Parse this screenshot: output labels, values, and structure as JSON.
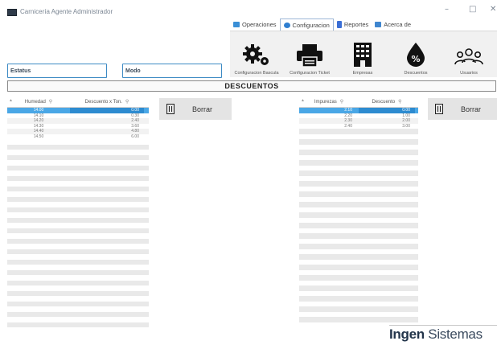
{
  "window": {
    "title": "Carnicería Agente Administrador",
    "minimize": "–",
    "maximize": "□",
    "close": "✕"
  },
  "menu": {
    "items": [
      {
        "label": "Operaciones",
        "color": "#3a8fd6",
        "active": false
      },
      {
        "label": "Configuracion",
        "color": "#2f7fd0",
        "active": true
      },
      {
        "label": "Reportes",
        "color": "#3b6fd6",
        "active": false
      },
      {
        "label": "Acerca de",
        "color": "#3f86cf",
        "active": false
      }
    ]
  },
  "toolbar": {
    "items": [
      {
        "label": "Configuracion Bascula",
        "icon": "gears-icon"
      },
      {
        "label": "Configuracion Ticket",
        "icon": "printer-icon"
      },
      {
        "label": "Empresas",
        "icon": "building-icon"
      },
      {
        "label": "Descuentos",
        "icon": "percent-drop-icon"
      },
      {
        "label": "Usuarios",
        "icon": "users-icon"
      }
    ]
  },
  "fields": {
    "estatus": "Estatus",
    "modo": "Modo"
  },
  "section": {
    "title": "DESCUENTOS"
  },
  "left_grid": {
    "col1": "Humedad",
    "col2": "Descuento x Ton.",
    "rows": [
      [
        "14.00",
        "0.00"
      ],
      [
        "14.10",
        "0.30"
      ],
      [
        "14.20",
        "2.40"
      ],
      [
        "14.30",
        "3.60"
      ],
      [
        "14.40",
        "4.80"
      ],
      [
        "14.50",
        "6.00"
      ]
    ]
  },
  "right_grid": {
    "col1": "Impurezas",
    "col2": "Descuento",
    "rows": [
      [
        "2.10",
        "0.00"
      ],
      [
        "2.20",
        "1.00"
      ],
      [
        "2.30",
        "2.00"
      ],
      [
        "2.40",
        "3.00"
      ]
    ]
  },
  "buttons": {
    "borrar_left": "Borrar",
    "borrar_right": "Borrar"
  },
  "brand": {
    "strong": "Ingen",
    "rest": "Sistemas"
  }
}
